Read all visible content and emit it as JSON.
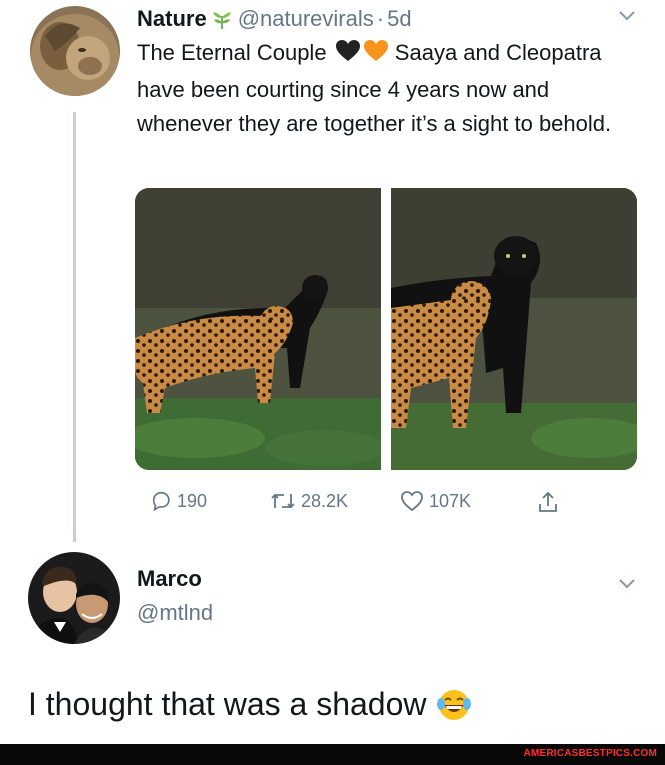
{
  "tweet": {
    "author_name": "Nature",
    "author_handle": "@naturevirals",
    "separator": "·",
    "time": "5d",
    "text_before_hearts": "The Eternal Couple",
    "text_after_hearts": " Saaya and Cleopatra have been courting since 4 years now and whenever they are together it’s a sight to behold.",
    "emoji": [
      "black-heart",
      "orange-heart"
    ],
    "leaf_emoji": "herb",
    "actions": {
      "replies": "190",
      "retweets": "28.2K",
      "likes": "107K"
    }
  },
  "reply_user": {
    "name": "Marco",
    "handle": "@mtlnd"
  },
  "reply": {
    "text": "I thought that was a shadow",
    "emoji": "laughing-tears"
  },
  "watermark": "AMERICASBESTPICS.COM",
  "colors": {
    "text": "#14171a",
    "muted": "#657786",
    "thread_line": "#c4cfd6",
    "watermark": "#ff2e2e",
    "bar": "#080808"
  }
}
